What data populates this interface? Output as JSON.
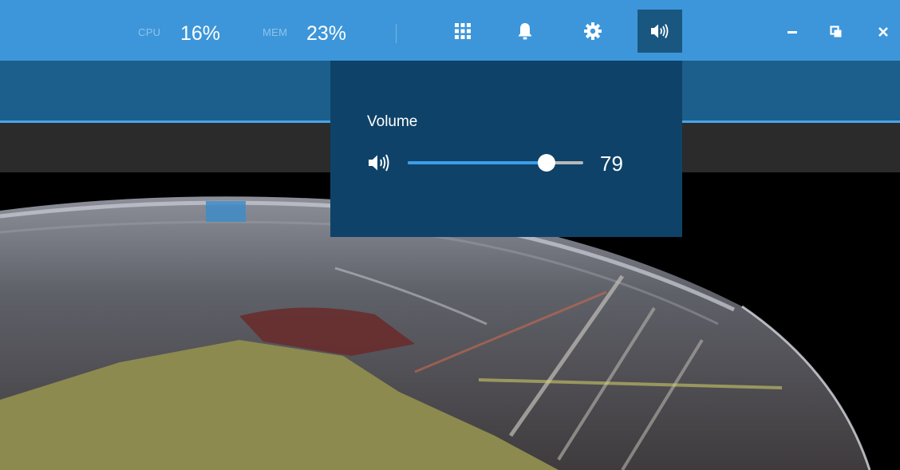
{
  "topbar": {
    "cpu_label": "CPU",
    "cpu_value": "16%",
    "mem_label": "MEM",
    "mem_value": "23%",
    "icons": [
      "grid-icon",
      "bell-icon",
      "gear-icon",
      "speaker-icon"
    ],
    "window_controls": [
      "minimize-icon",
      "restore-icon",
      "close-icon"
    ]
  },
  "volume_panel": {
    "title": "Volume",
    "value": "79",
    "level": 0.79
  },
  "colors": {
    "topbar": "#3d96d9",
    "subbar": "#1c5f8d",
    "panel": "#0f4268",
    "slider_fill": "#3d9ee8"
  }
}
